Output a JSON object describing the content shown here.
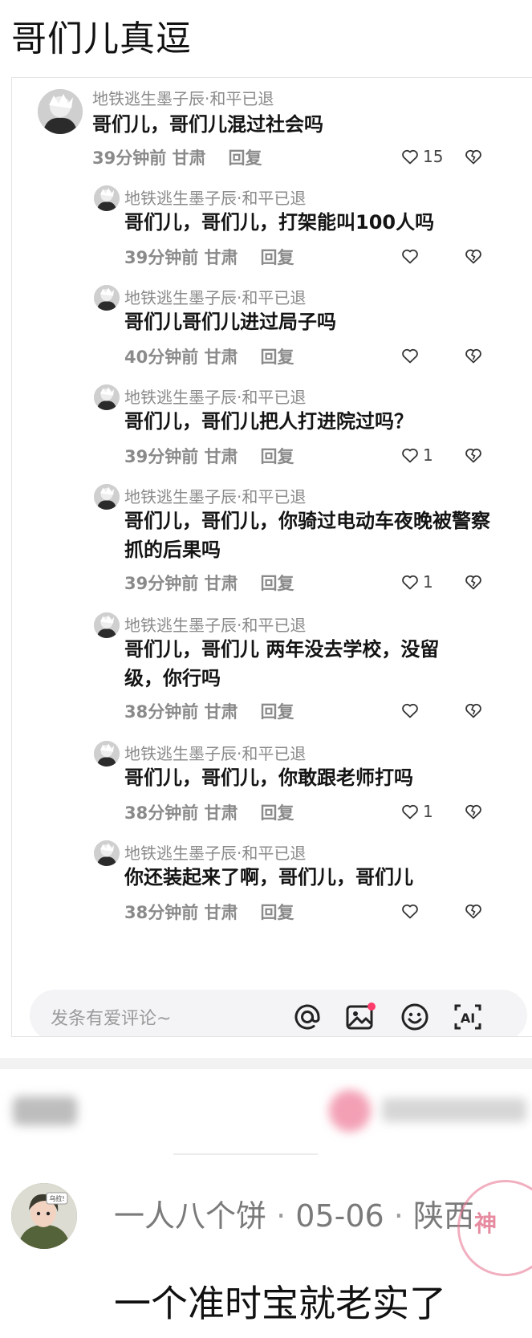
{
  "page": {
    "title": "哥们儿真逗"
  },
  "colors": {
    "text": "#141414",
    "meta": "#8a8a8a",
    "accent": "#ff3b6b",
    "stamp": "#e46e8c"
  },
  "comments": [
    {
      "user": "地铁逃生墨子辰·和平已退",
      "text": "哥们儿，哥们儿混过社会吗",
      "meta": "39分钟前 甘肃",
      "reply": "回复",
      "likes": "15"
    },
    {
      "user": "地铁逃生墨子辰·和平已退",
      "text": "哥们儿，哥们儿，打架能叫100人吗",
      "meta": "39分钟前 甘肃",
      "reply": "回复",
      "likes": ""
    },
    {
      "user": "地铁逃生墨子辰·和平已退",
      "text": "哥们儿哥们儿进过局子吗",
      "meta": "40分钟前 甘肃",
      "reply": "回复",
      "likes": ""
    },
    {
      "user": "地铁逃生墨子辰·和平已退",
      "text": "哥们儿，哥们儿把人打进院过吗？",
      "meta": "39分钟前 甘肃",
      "reply": "回复",
      "likes": "1"
    },
    {
      "user": "地铁逃生墨子辰·和平已退",
      "text": "哥们儿，哥们儿，你骑过电动车夜晚被警察抓的后果吗",
      "meta": "39分钟前 甘肃",
      "reply": "回复",
      "likes": "1"
    },
    {
      "user": "地铁逃生墨子辰·和平已退",
      "text": "哥们儿，哥们儿 两年没去学校，没留级，你行吗",
      "meta": "38分钟前 甘肃",
      "reply": "回复",
      "likes": ""
    },
    {
      "user": "地铁逃生墨子辰·和平已退",
      "text": "哥们儿，哥们儿，你敢跟老师打吗",
      "meta": "38分钟前 甘肃",
      "reply": "回复",
      "likes": "1"
    },
    {
      "user": "地铁逃生墨子辰·和平已退",
      "text": "你还装起来了啊，哥们儿，哥们儿",
      "meta": "38分钟前 甘肃",
      "reply": "回复",
      "likes": ""
    }
  ],
  "input_bar": {
    "placeholder": "发条有爱评论~",
    "icons": [
      "at-icon",
      "image-icon",
      "emoji-icon",
      "ai-icon"
    ],
    "ai_label": "AI"
  },
  "bottom_comment": {
    "user": "一人八个饼",
    "date": "05-06",
    "location": "陕西",
    "text": "一个准时宝就老实了",
    "avatar_caption": "乌拉!"
  },
  "stamp": {
    "text": "神"
  }
}
